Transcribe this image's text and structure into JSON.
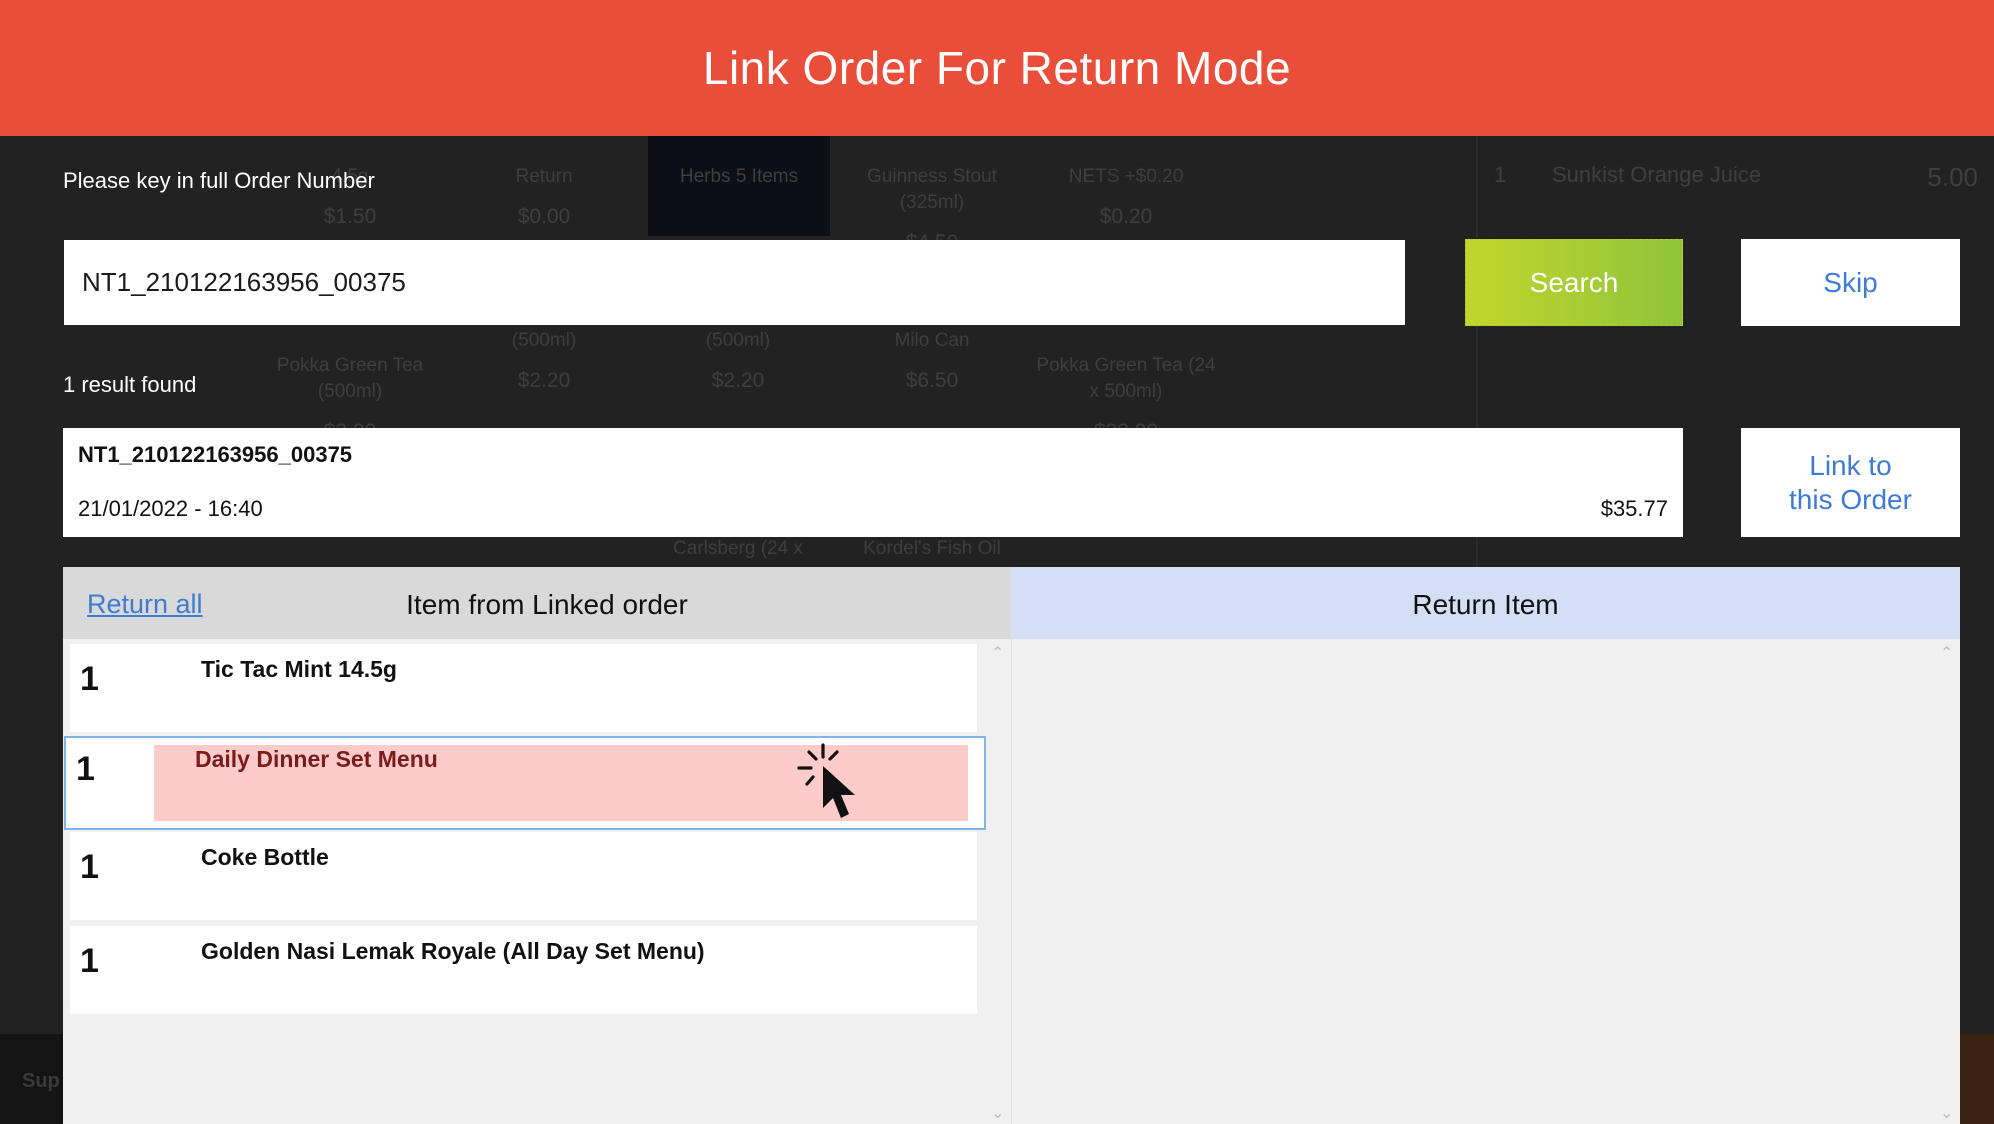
{
  "modal": {
    "title": "Link Order For Return Mode",
    "prompt": "Please key in full Order Number",
    "order_input_value": "NT1_210122163956_00375",
    "search_label": "Search",
    "skip_label": "Skip",
    "result_count": "1 result found",
    "link_label_line1": "Link to",
    "link_label_line2": "this Order"
  },
  "result": {
    "order_number": "NT1_210122163956_00375",
    "datetime": "21/01/2022 - 16:40",
    "total": "$35.77"
  },
  "left_panel": {
    "return_all": "Return all",
    "title": "Item from Linked order",
    "items": [
      {
        "qty": "1",
        "name": "Tic Tac Mint 14.5g"
      },
      {
        "qty": "1",
        "name": "Daily Dinner Set Menu"
      },
      {
        "qty": "1",
        "name": "Coke Bottle"
      },
      {
        "qty": "1",
        "name": "Golden Nasi Lemak Royale (All Day Set Menu)"
      }
    ]
  },
  "right_panel": {
    "title": "Return Item"
  },
  "background": {
    "tiles": [
      {
        "name": "4.5g",
        "price": "$1.50"
      },
      {
        "name": "Return",
        "price": "$0.00"
      },
      {
        "name": "Herbs\n5 Items",
        "price": ""
      },
      {
        "name": "Guinness Stout (325ml)",
        "price": "$4.50"
      },
      {
        "name": "NETS +$0.20",
        "price": "$0.20"
      },
      {
        "name": "Pokka Green Tea (500ml)",
        "price": "$2.20"
      },
      {
        "name": "(500ml)",
        "price": "$2.20"
      },
      {
        "name": "(500ml)",
        "price": "$2.20"
      },
      {
        "name": "Milo Can",
        "price": "$6.50"
      },
      {
        "name": "Pokka Green Tea (24 x 500ml)",
        "price": "$38.00"
      },
      {
        "name": "Carlsberg (24 x",
        "price": ""
      },
      {
        "name": "Kordel's Fish Oil",
        "price": ""
      }
    ],
    "cart_line": {
      "qty": "1",
      "name": "Sunkist Orange Juice",
      "price": "5.00"
    },
    "bottom_label": "Sup"
  },
  "colors": {
    "header": "#e94e3a",
    "search_button": "#a6cc33",
    "link_text": "#3f7bd3",
    "highlight": "#fecbcb",
    "right_panel_header": "#d4dff6"
  }
}
